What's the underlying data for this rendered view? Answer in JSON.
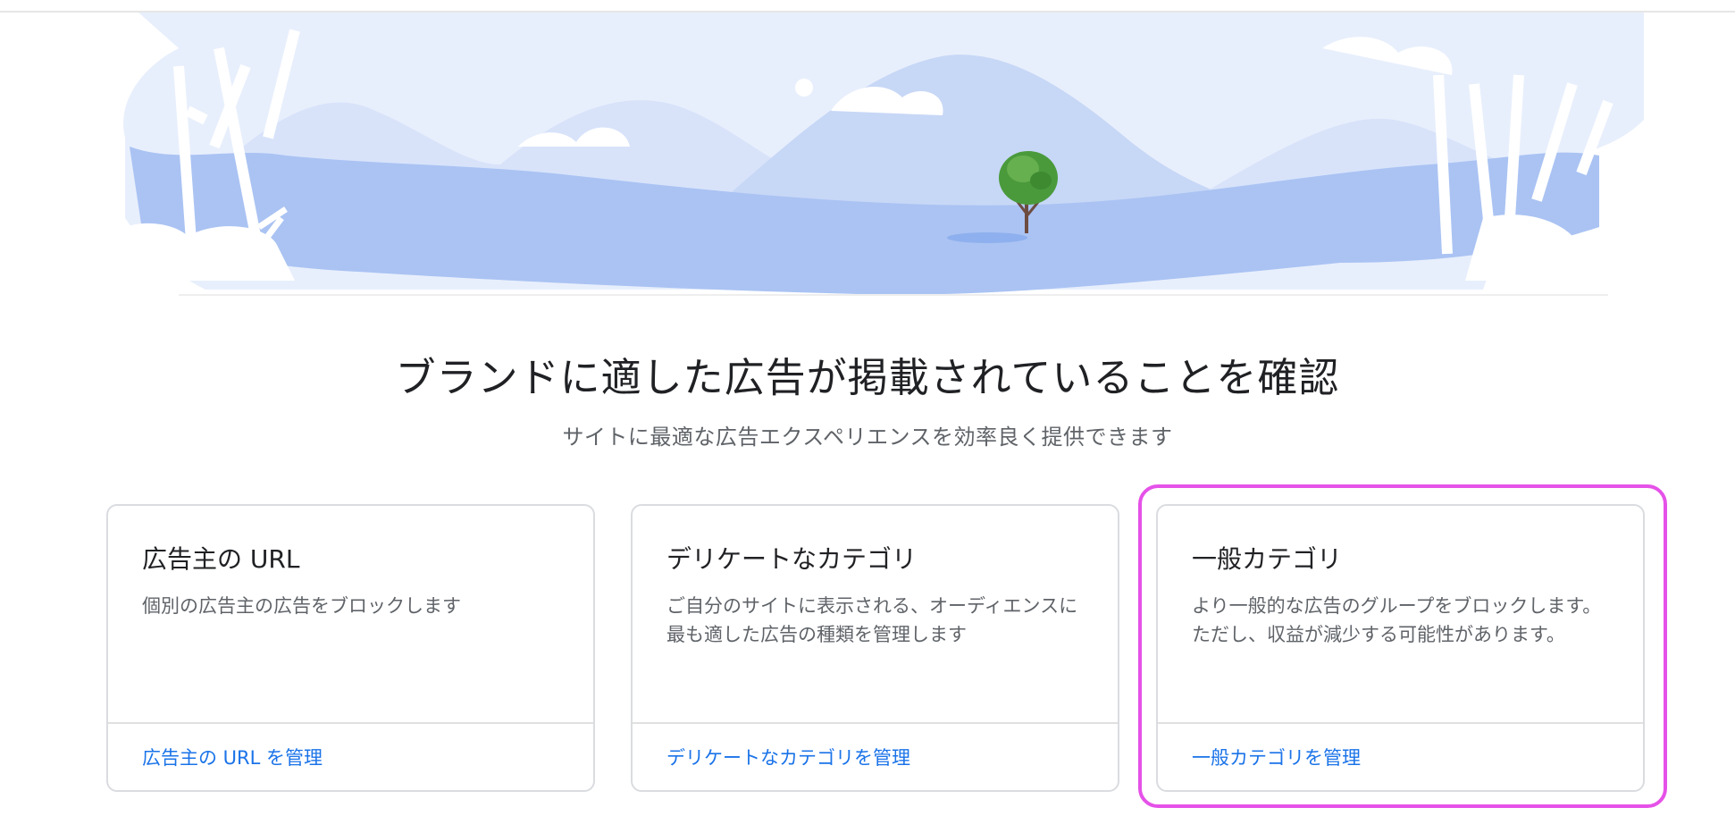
{
  "header": {
    "headline": "ブランドに適した広告が掲載されていることを確認",
    "subheadline": "サイトに最適な広告エクスペリエンスを効率良く提供できます"
  },
  "cards": [
    {
      "title": "広告主の URL",
      "description": "個別の広告主の広告をブロックします",
      "link": "広告主の URL を管理"
    },
    {
      "title": "デリケートなカテゴリ",
      "description": "ご自分のサイトに表示される、オーディエンスに最も適した広告の種類を管理します",
      "link": "デリケートなカテゴリを管理"
    },
    {
      "title": "一般カテゴリ",
      "description": "より一般的な広告のグループをブロックします。ただし、収益が減少する可能性があります。",
      "link": "一般カテゴリを管理"
    }
  ],
  "colors": {
    "link": "#1a73e8",
    "highlight": "#e552e8",
    "hero_dark": "#aac3f3",
    "hero_light": "#e8effc"
  }
}
